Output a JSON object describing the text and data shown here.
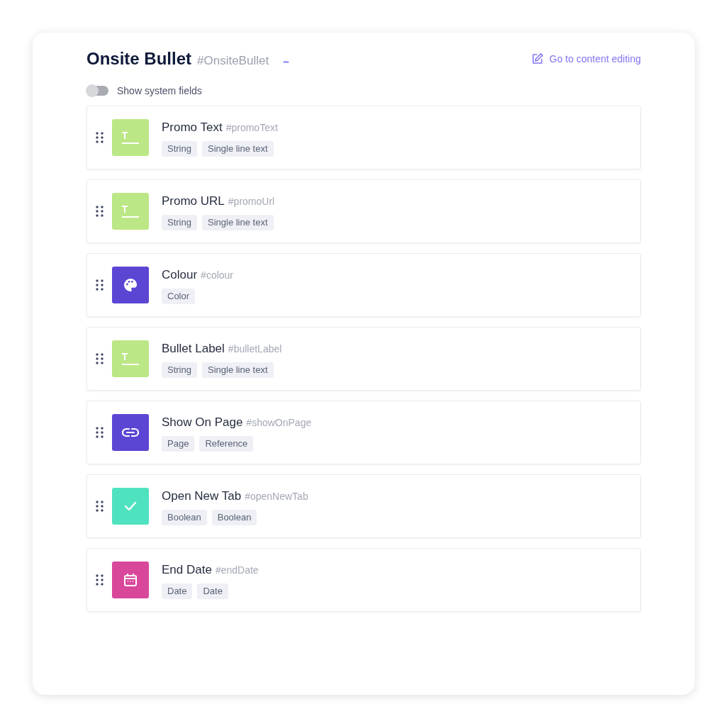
{
  "header": {
    "title": "Onsite Bullet",
    "api_id": "#OnsiteBullet",
    "more_menu": "•••",
    "action_link": "Go to content editing"
  },
  "system_fields_toggle": {
    "label": "Show system fields",
    "on": false
  },
  "fields": [
    {
      "kind": "text",
      "color": "#bce786",
      "name": "Promo Text",
      "api_id": "#promoText",
      "tags": [
        "String",
        "Single line text"
      ]
    },
    {
      "kind": "text",
      "color": "#bce786",
      "name": "Promo URL",
      "api_id": "#promoUrl",
      "tags": [
        "String",
        "Single line text"
      ]
    },
    {
      "kind": "palette",
      "color": "#5b46d4",
      "name": "Colour",
      "api_id": "#colour",
      "tags": [
        "Color"
      ]
    },
    {
      "kind": "text",
      "color": "#bce786",
      "name": "Bullet Label",
      "api_id": "#bulletLabel",
      "tags": [
        "String",
        "Single line text"
      ]
    },
    {
      "kind": "link",
      "color": "#5b46d4",
      "name": "Show On Page",
      "api_id": "#showOnPage",
      "tags": [
        "Page",
        "Reference"
      ]
    },
    {
      "kind": "check",
      "color": "#4fe2c0",
      "name": "Open New Tab",
      "api_id": "#openNewTab",
      "tags": [
        "Boolean",
        "Boolean"
      ]
    },
    {
      "kind": "calendar",
      "color": "#d9479b",
      "name": "End Date",
      "api_id": "#endDate",
      "tags": [
        "Date",
        "Date"
      ]
    }
  ]
}
